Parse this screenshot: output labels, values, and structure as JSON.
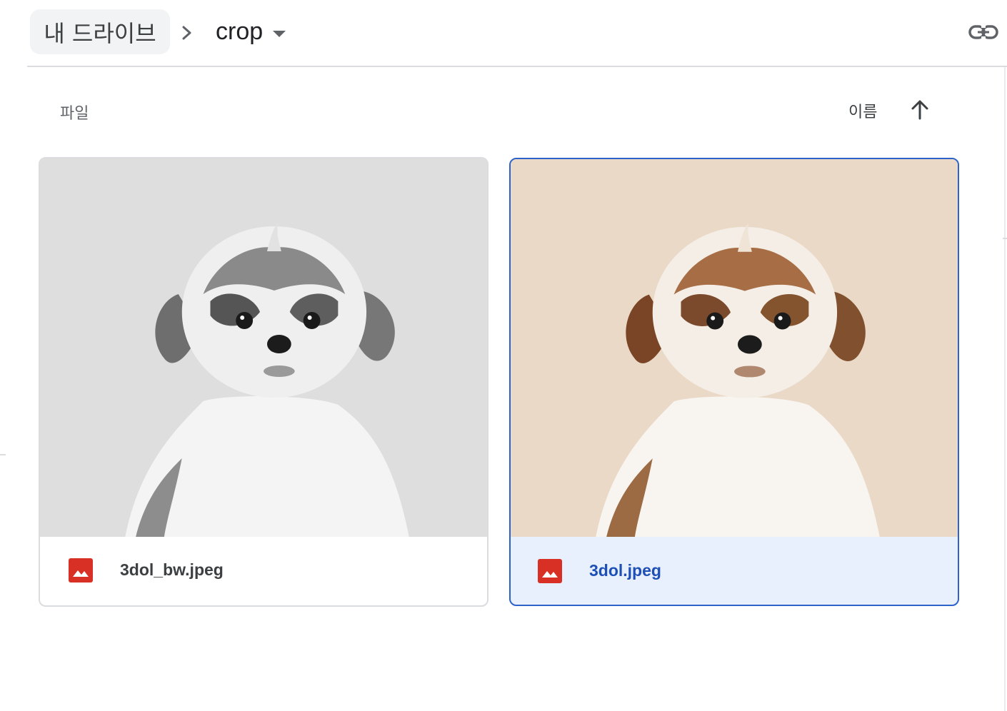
{
  "breadcrumb": {
    "root_label": "내 드라이브",
    "current_folder": "crop"
  },
  "section": {
    "label": "파일",
    "sort_label": "이름",
    "sort_direction": "ascending"
  },
  "files": [
    {
      "name": "3dol_bw.jpeg",
      "type": "image",
      "icon": "image-file-icon",
      "selected": false,
      "thumbnail": "grayscale"
    },
    {
      "name": "3dol.jpeg",
      "type": "image",
      "icon": "image-file-icon",
      "selected": true,
      "thumbnail": "color"
    }
  ],
  "colors": {
    "accent": "#2d63c8",
    "selected_bg": "#e8f0fe",
    "image_icon": "#d93025",
    "divider": "#dadce0"
  }
}
